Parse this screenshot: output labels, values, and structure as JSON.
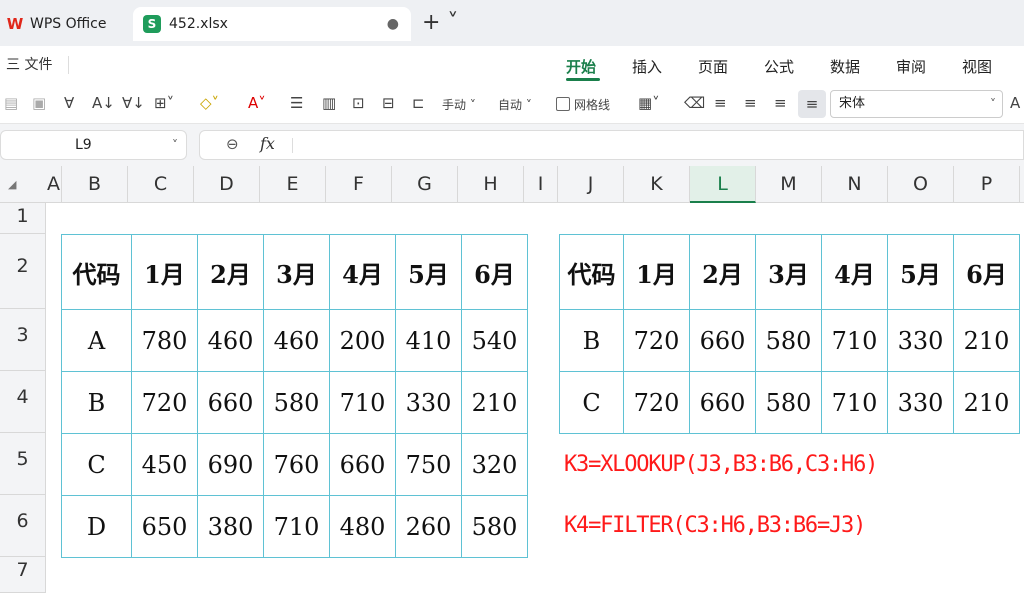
{
  "tabs": {
    "app_label": "WPS Office",
    "file_label": "452.xlsx",
    "logo_glyph": "W",
    "file_icon_glyph": "S",
    "modified_dot": "●",
    "new_tab": "+ ˅"
  },
  "menu": {
    "file": "三 文件",
    "ribbon_tabs": [
      "开始",
      "插入",
      "页面",
      "公式",
      "数据",
      "审阅",
      "视图"
    ]
  },
  "toolbar": {
    "manual": "手动 ˅",
    "auto": "自动 ˅",
    "gridlines": "网格线",
    "font": "宋体"
  },
  "formula_bar": {
    "cell_ref": "L9",
    "fx": "fx",
    "content": ""
  },
  "columns": [
    "A",
    "B",
    "C",
    "D",
    "E",
    "F",
    "G",
    "H",
    "I",
    "J",
    "K",
    "L",
    "M",
    "N",
    "O",
    "P"
  ],
  "selected_column": "L",
  "rows": [
    "1",
    "2",
    "3",
    "4",
    "5",
    "6",
    "7"
  ],
  "left_table": {
    "header": [
      "代码",
      "1月",
      "2月",
      "3月",
      "4月",
      "5月",
      "6月"
    ],
    "rows": [
      [
        "A",
        "780",
        "460",
        "460",
        "200",
        "410",
        "540"
      ],
      [
        "B",
        "720",
        "660",
        "580",
        "710",
        "330",
        "210"
      ],
      [
        "C",
        "450",
        "690",
        "760",
        "660",
        "750",
        "320"
      ],
      [
        "D",
        "650",
        "380",
        "710",
        "480",
        "260",
        "580"
      ]
    ]
  },
  "right_table": {
    "header": [
      "代码",
      "1月",
      "2月",
      "3月",
      "4月",
      "5月",
      "6月"
    ],
    "rows": [
      [
        "B",
        "720",
        "660",
        "580",
        "710",
        "330",
        "210"
      ],
      [
        "C",
        "720",
        "660",
        "580",
        "710",
        "330",
        "210"
      ]
    ]
  },
  "formulas": [
    "K3=XLOOKUP(J3,B3:B6,C3:H6)",
    "K4=FILTER(C3:H6,B3:B6=J3)"
  ],
  "colors": {
    "accent": "#1a7f4b",
    "grid_border": "#5fc2d4",
    "formula_text": "#ff1a1a"
  }
}
